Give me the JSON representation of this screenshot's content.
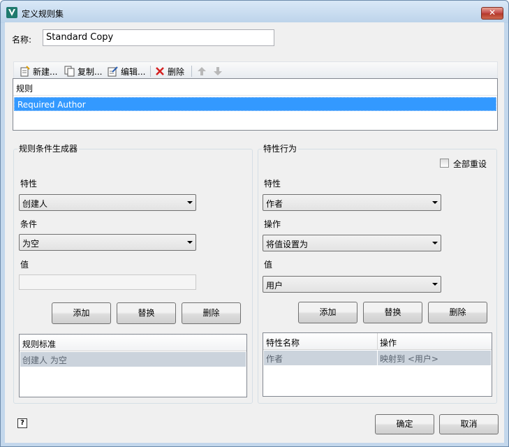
{
  "window": {
    "title": "定义规则集",
    "close_glyph": "✕"
  },
  "name_field": {
    "label": "名称:",
    "value": "Standard Copy"
  },
  "toolbar": {
    "new_label": "新建...",
    "copy_label": "复制...",
    "edit_label": "编辑...",
    "delete_label": "删除"
  },
  "rules_list": {
    "header": "规则",
    "items": [
      "Required Author"
    ]
  },
  "rule_builder": {
    "title": "规则条件生成器",
    "property_label": "特性",
    "property_value": "创建人",
    "condition_label": "条件",
    "condition_value": "为空",
    "value_label": "值",
    "add_label": "添加",
    "replace_label": "替换",
    "delete_label": "删除",
    "criteria_header": "规则标准",
    "criteria_rows": [
      "创建人 为空"
    ]
  },
  "property_behavior": {
    "title": "特性行为",
    "reset_all_label": "全部重设",
    "reset_all_checked": false,
    "property_label": "特性",
    "property_value": "作者",
    "operation_label": "操作",
    "operation_value": "将值设置为",
    "value_label": "值",
    "value_value": "用户",
    "add_label": "添加",
    "replace_label": "替换",
    "delete_label": "删除",
    "table_headers": [
      "特性名称",
      "操作"
    ],
    "table_rows": [
      [
        "作者",
        "映射到 <用户>"
      ]
    ]
  },
  "footer": {
    "help_glyph": "?",
    "ok_label": "确定",
    "cancel_label": "取消"
  },
  "colors": {
    "selection": "#3399ff",
    "title_gradient_top": "#d9e8f7",
    "close_red": "#c75050"
  }
}
